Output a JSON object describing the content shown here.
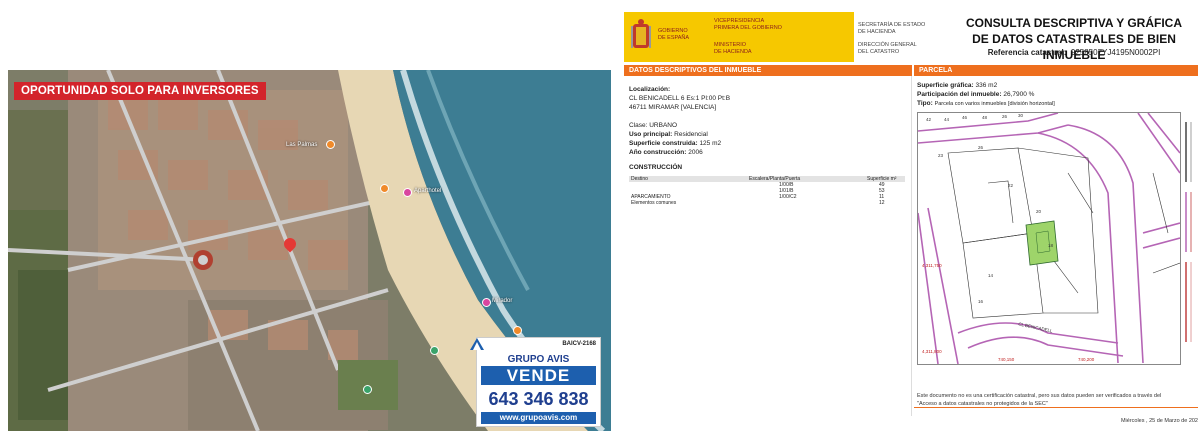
{
  "promo": {
    "banner": "OPORTUNIDAD SOLO PARA INVERSORES"
  },
  "aerial_labels": [
    "Las Palmas",
    "Aparthotel",
    "Mirador"
  ],
  "sale_card": {
    "ref": "BAICV-2168",
    "brand": "GRUPO AVIS",
    "headline": "VENDE",
    "phone": "643 346 838",
    "web": "www.grupoavis.com"
  },
  "header": {
    "gov1": [
      "GOBIERNO",
      "DE ESPAÑA"
    ],
    "gov2": [
      "VICEPRESIDENCIA",
      "PRIMERA DEL GOBIERNO"
    ],
    "gov3": [
      "MINISTERIO",
      "DE HACIENDA"
    ],
    "gov4": [
      "SECRETARÍA DE ESTADO",
      "DE HACIENDA"
    ],
    "gov5": [
      "DIRECCIÓN GENERAL",
      "DEL CATASTRO"
    ],
    "title_line1": "CONSULTA DESCRIPTIVA Y GRÁFICA",
    "title_line2": "DE DATOS CATASTRALES DE BIEN INMUEBLE",
    "ref_label": "Referencia catastral:",
    "ref_value": "9258507YJ4195N0002PI"
  },
  "left_section": {
    "title": "DATOS DESCRIPTIVOS DEL INMUEBLE",
    "loc_label": "Localización:",
    "loc_line1": "CL BENICADELL 6 Es:1 Pl:00 Pt:B",
    "loc_line2": "46711 MIRAMAR [VALENCIA]",
    "clase": "Clase: URBANO",
    "uso_label": "Uso principal:",
    "uso_value": "Residencial",
    "sup_label": "Superficie construida:",
    "sup_value": "125 m2",
    "anio_label": "Año construcción:",
    "anio_value": "2006",
    "construccion_title": "CONSTRUCCIÓN",
    "table_headers": [
      "Destino",
      "Escalera/Planta/Puerta",
      "Superficie m²"
    ],
    "table_rows": [
      [
        "",
        "1/00/B",
        "49"
      ],
      [
        "",
        "1/01/B",
        "53"
      ],
      [
        "APARCAMIENTO",
        "1/00/C2",
        "11"
      ],
      [
        "Elementos comunes",
        "",
        "12"
      ]
    ]
  },
  "right_section": {
    "title": "PARCELA",
    "sup_grafica_label": "Superficie gráfica:",
    "sup_grafica_value": "336 m2",
    "participacion_label": "Participación del inmueble:",
    "participacion_value": "26,7900 %",
    "tipo_label": "Tipo:",
    "tipo_value": "Parcela con varios inmuebles [división horizontal]",
    "map_labels": [
      "42",
      "44",
      "46",
      "48",
      "26",
      "30",
      "26",
      "23",
      "22",
      "20",
      "18",
      "14",
      "16",
      "CL BENICADELL",
      "4,311,750",
      "4,311,800",
      "740,150",
      "740,200"
    ],
    "note": "Este documento no es una certificación catastral, pero sus datos pueden ser verificados a través del \"Acceso a datos catastrales no protegidos de la SEC\"",
    "date": "Miércoles , 25 de Marzo de 202"
  },
  "colors": {
    "accent_orange": "#ee6f1e",
    "gov_yellow": "#f6c800",
    "parcel_green": "#9ed46a",
    "sale_blue": "#1d5fae",
    "banner_red": "#d3242b"
  }
}
